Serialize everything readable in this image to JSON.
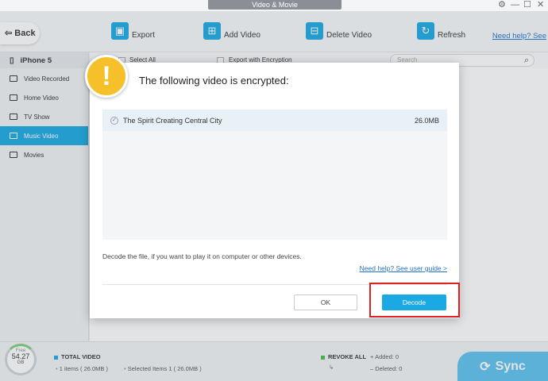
{
  "window": {
    "title": "Video & Movie"
  },
  "toolbar": {
    "back_label": "Back",
    "export_label": "Export",
    "add_video_label": "Add Video",
    "delete_video_label": "Delete Video",
    "refresh_label": "Refresh",
    "help_link": "Need help? See"
  },
  "sidebar": {
    "device": "iPhone 5",
    "items": [
      {
        "label": "Video Recorded",
        "icon": "video-camera-icon"
      },
      {
        "label": "Home Video",
        "icon": "home-video-icon"
      },
      {
        "label": "TV Show",
        "icon": "tv-icon"
      },
      {
        "label": "Music Video",
        "icon": "music-video-icon"
      },
      {
        "label": "Movies",
        "icon": "film-icon"
      }
    ]
  },
  "listbar": {
    "select_all": "Select All",
    "export_encryption": "Export with Encryption",
    "search_placeholder": "Search"
  },
  "footer": {
    "free_label": "Free",
    "free_value": "54.27",
    "free_unit": "GB",
    "total_video_label": "TOTAL VIDEO",
    "total_items": "1 items ( 26.0MB )",
    "selected_items": "Selected Items 1 ( 26.0MB )",
    "revoke_all_label": "REVOKE ALL",
    "added": "Added: 0",
    "deleted": "Deleted: 0",
    "sync_label": "Sync"
  },
  "dialog": {
    "title": "The following video is encrypted:",
    "rows": [
      {
        "name": "The Spirit Creating Central City",
        "size": "26.0MB"
      }
    ],
    "message": "Decode the file, if you want to play it on computer or other devices.",
    "help_link": "Need help? See user guide >",
    "ok_label": "OK",
    "decode_label": "Decode"
  },
  "colors": {
    "accent": "#1aa9e3",
    "warning": "#f6c02a",
    "highlight": "#e02020",
    "sync": "#5dc3ef"
  }
}
